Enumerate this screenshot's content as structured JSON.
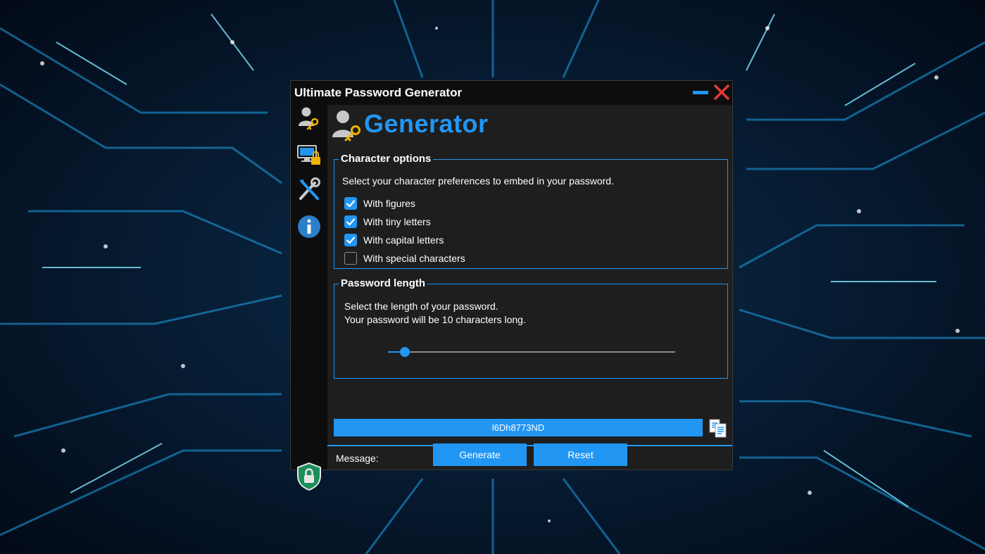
{
  "window": {
    "title": "Ultimate Password Generator"
  },
  "sidebar": {
    "items": [
      {
        "icon": "user-key-icon"
      },
      {
        "icon": "monitor-lock-icon"
      },
      {
        "icon": "tools-icon"
      },
      {
        "icon": "info-icon"
      }
    ],
    "footer_icon": "shield-lock-icon"
  },
  "page": {
    "heading": "Generator"
  },
  "character_options": {
    "legend": "Character options",
    "description": "Select your character preferences to embed in your password.",
    "options": [
      {
        "label": "With figures",
        "checked": true
      },
      {
        "label": "With tiny letters",
        "checked": true
      },
      {
        "label": "With capital letters",
        "checked": true
      },
      {
        "label": "With special characters",
        "checked": false
      }
    ]
  },
  "password_length": {
    "legend": "Password length",
    "description_line1": "Select the length of your password.",
    "description_line2": "Your password will be 10 characters long.",
    "slider_fraction": 0.06
  },
  "actions": {
    "generate_label": "Generate",
    "reset_label": "Reset"
  },
  "output": {
    "password": "l6Dh8773ND"
  },
  "status": {
    "message_label": "Message:"
  },
  "colors": {
    "accent": "#2196f3",
    "close": "#e53935",
    "window_bg": "#1e1e1e",
    "titlebar_bg": "#0d0d0d"
  }
}
